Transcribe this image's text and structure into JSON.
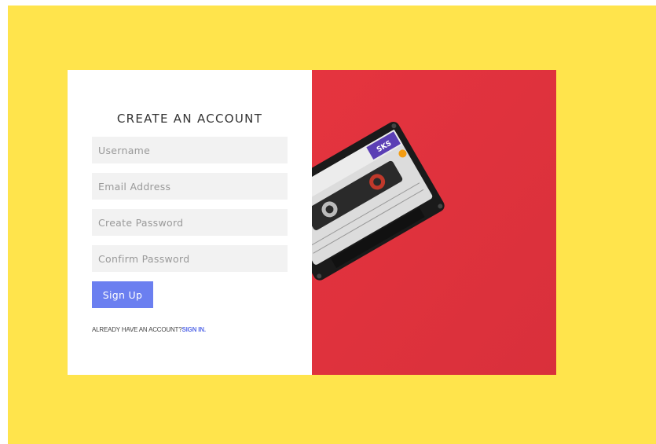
{
  "form": {
    "title": "CREATE AN ACCOUNT",
    "username_placeholder": "Username",
    "email_placeholder": "Email Address",
    "create_password_placeholder": "Create Password",
    "confirm_password_placeholder": "Confirm Password",
    "signup_label": "Sign Up",
    "already_text": "ALREADY HAVE AN ACCOUNT?",
    "signin_link": "SIGN IN."
  },
  "image": {
    "description_icon": "cassette-tape-photo",
    "cassette_label": "SKS"
  },
  "colors": {
    "background": "#ffe44c",
    "photo_red": "#e73b47",
    "button": "#6b7ff0",
    "link": "#5a6de8"
  }
}
